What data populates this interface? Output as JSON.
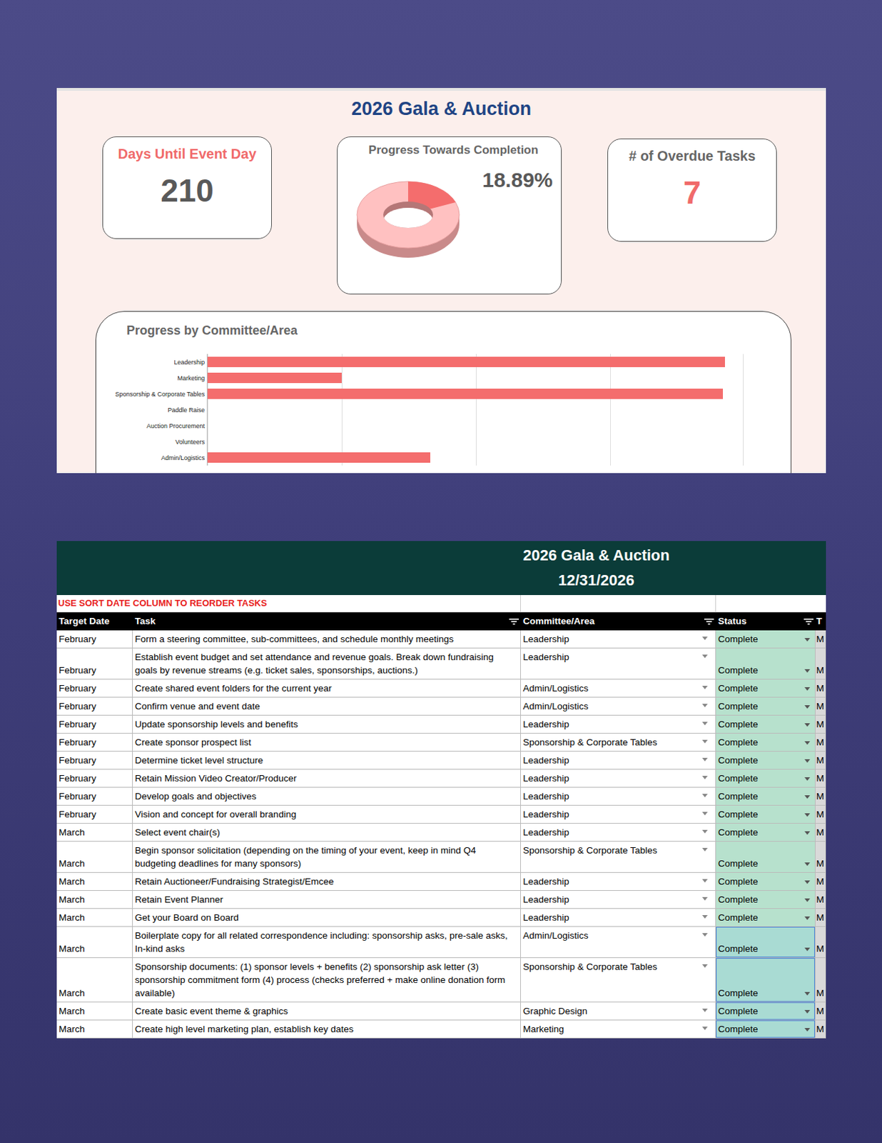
{
  "dashboard": {
    "title": "2026 Gala & Auction",
    "days": {
      "title": "Days Until Event Day",
      "value": "210"
    },
    "progress": {
      "title": "Progress Towards Completion",
      "reading": "18.89%",
      "level": 0.1889
    },
    "overdue": {
      "title": "# of Overdue Tasks",
      "value": "7"
    },
    "chart": {
      "title": "Progress by Committee/Area",
      "categories": [
        "Leadership",
        "Marketing",
        "Sponsorship & Corporate Tables",
        "Paddle Raise",
        "Auction Procurement",
        "Volunteers",
        "Admin/Logistics"
      ],
      "values": [
        0.966,
        0.25,
        0.962,
        0,
        0,
        0,
        0.416
      ]
    }
  },
  "tracker": {
    "title": "2026 Gala & Auction",
    "date": "12/31/2026",
    "note": "USE SORT DATE COLUMN TO REORDER TASKS",
    "columns": [
      "Target Date",
      "Task",
      "Committee/Area",
      "Status",
      "T"
    ],
    "rows": [
      {
        "cells": [
          "February",
          "Form a steering committee, sub-committees, and schedule monthly meetings",
          "Leadership",
          "Complete",
          "M"
        ],
        "selected": false
      },
      {
        "cells": [
          "February",
          "Establish event budget and set attendance and revenue goals. Break down fundraising goals by revenue streams (e.g. ticket sales, sponsorships, auctions.)",
          "Leadership",
          "Complete",
          "M"
        ],
        "selected": false
      },
      {
        "cells": [
          "February",
          "Create shared event folders for the current year",
          "Admin/Logistics",
          "Complete",
          "M"
        ],
        "selected": false
      },
      {
        "cells": [
          "February",
          "Confirm venue and event date",
          "Admin/Logistics",
          "Complete",
          "M"
        ],
        "selected": false
      },
      {
        "cells": [
          "February",
          "Update sponsorship levels and benefits",
          "Leadership",
          "Complete",
          "M"
        ],
        "selected": false
      },
      {
        "cells": [
          "February",
          "Create sponsor prospect list",
          "Sponsorship & Corporate Tables",
          "Complete",
          "M"
        ],
        "selected": false
      },
      {
        "cells": [
          "February",
          "Determine ticket level structure",
          "Leadership",
          "Complete",
          "M"
        ],
        "selected": false
      },
      {
        "cells": [
          "February",
          "Retain Mission Video Creator/Producer",
          "Leadership",
          "Complete",
          "M"
        ],
        "selected": false
      },
      {
        "cells": [
          "February",
          "Develop goals and objectives",
          "Leadership",
          "Complete",
          "M"
        ],
        "selected": false
      },
      {
        "cells": [
          "February",
          "Vision and concept for overall branding",
          "Leadership",
          "Complete",
          "M"
        ],
        "selected": false
      },
      {
        "cells": [
          "March",
          "Select event chair(s)",
          "Leadership",
          "Complete",
          "M"
        ],
        "selected": false
      },
      {
        "cells": [
          "March",
          "Begin sponsor solicitation (depending on the timing of your event, keep in mind Q4 budgeting deadlines for many sponsors)",
          "Sponsorship & Corporate Tables",
          "Complete",
          "M"
        ],
        "selected": false
      },
      {
        "cells": [
          "March",
          "Retain Auctioneer/Fundraising Strategist/Emcee",
          "Leadership",
          "Complete",
          "M"
        ],
        "selected": false
      },
      {
        "cells": [
          "March",
          "Retain Event Planner",
          "Leadership",
          "Complete",
          "M"
        ],
        "selected": false
      },
      {
        "cells": [
          "March",
          "Get your Board on Board",
          "Leadership",
          "Complete",
          "M"
        ],
        "selected": false
      },
      {
        "cells": [
          "March",
          "Boilerplate copy for all related correspondence including: sponsorship asks, pre-sale asks, In-kind asks",
          "Admin/Logistics",
          "Complete",
          "M"
        ],
        "selected": true
      },
      {
        "cells": [
          "March",
          "Sponsorship documents: (1) sponsor levels + benefits (2) sponsorship ask letter (3) sponsorship commitment form (4) process (checks preferred + make online donation form available)",
          "Sponsorship & Corporate Tables",
          "Complete",
          "M"
        ],
        "selected": true
      },
      {
        "cells": [
          "March",
          "Create basic event theme & graphics",
          "Graphic Design",
          "Complete",
          "M"
        ],
        "selected": true
      },
      {
        "cells": [
          "March",
          "Create high level marketing plan, establish key dates",
          "Marketing",
          "Complete",
          "M"
        ],
        "selected": true
      }
    ]
  }
}
